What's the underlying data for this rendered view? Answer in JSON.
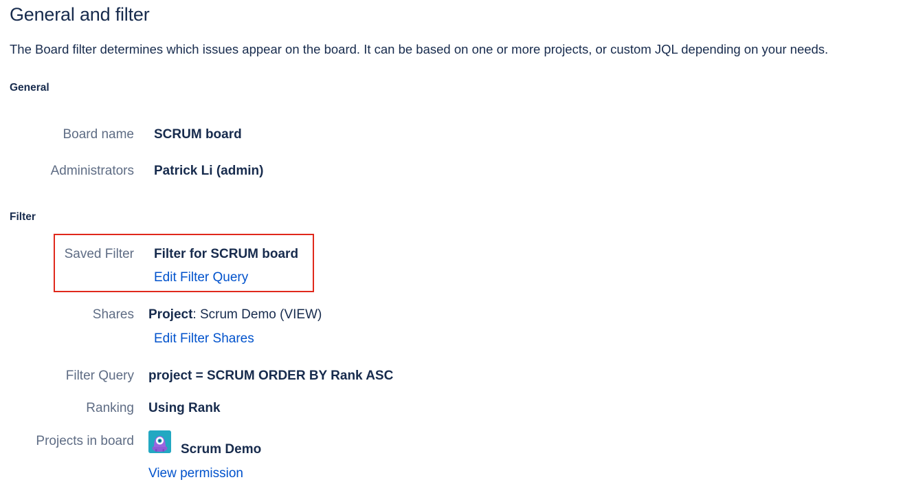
{
  "header": {
    "title": "General and filter",
    "description": "The Board filter determines which issues appear on the board. It can be based on one or more projects, or custom JQL depending on your needs."
  },
  "general": {
    "heading": "General",
    "board_name_label": "Board name",
    "board_name_value": "SCRUM board",
    "administrators_label": "Administrators",
    "administrators_value": "Patrick Li (admin)"
  },
  "filter": {
    "heading": "Filter",
    "saved_filter_label": "Saved Filter",
    "saved_filter_value": "Filter for SCRUM board",
    "edit_filter_query_link": "Edit Filter Query",
    "shares_label": "Shares",
    "shares_prefix": "Project",
    "shares_value": ": Scrum Demo (VIEW)",
    "edit_filter_shares_link": "Edit Filter Shares",
    "filter_query_label": "Filter Query",
    "filter_query_value": "project = SCRUM ORDER BY Rank ASC",
    "ranking_label": "Ranking",
    "ranking_value": "Using Rank",
    "projects_label": "Projects in board",
    "project_name": "Scrum Demo",
    "project_icon": "project-avatar-icon",
    "view_permission_link": "View permission"
  },
  "colors": {
    "text": "#172b4d",
    "label": "#5e6c84",
    "link": "#0052cc",
    "highlight": "#e0281b",
    "avatar_bg": "#23a8c2"
  }
}
